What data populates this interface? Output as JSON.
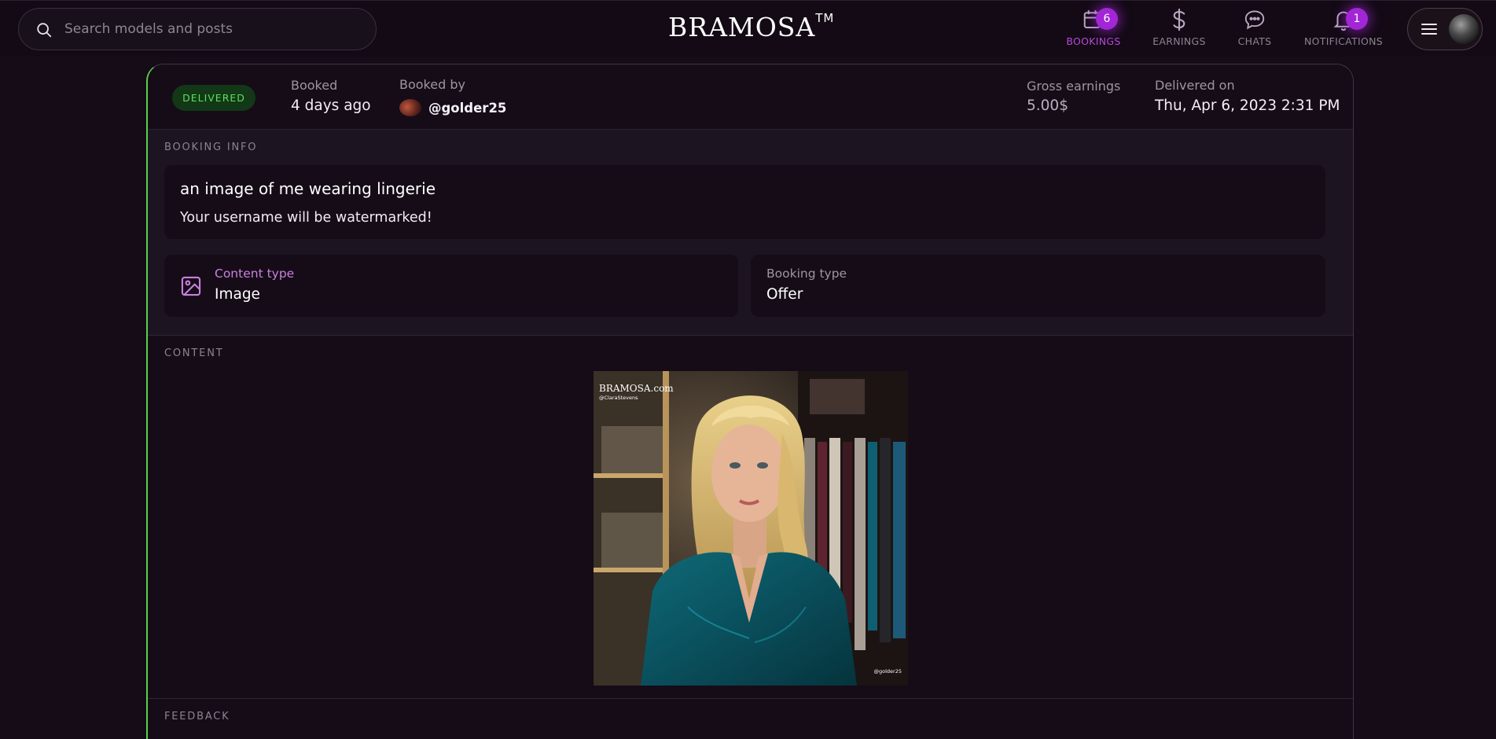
{
  "search": {
    "placeholder": "Search models and posts"
  },
  "brand": {
    "name": "BRAMOSA",
    "mark": "TM"
  },
  "nav": [
    {
      "label": "BOOKINGS",
      "icon": "calendar-icon",
      "badge": "6",
      "active": true
    },
    {
      "label": "EARNINGS",
      "icon": "dollar-icon",
      "badge": "",
      "active": false
    },
    {
      "label": "CHATS",
      "icon": "chat-bubble-icon",
      "badge": "",
      "active": false
    },
    {
      "label": "NOTIFICATIONS",
      "icon": "bell-icon",
      "badge": "1",
      "active": false
    }
  ],
  "booking": {
    "status": "DELIVERED",
    "booked_label": "Booked",
    "booked_value": "4 days ago",
    "booked_by_label": "Booked by",
    "booked_by_value": "@golder25",
    "gross_label": "Gross earnings",
    "gross_value": "5.00$",
    "delivered_label": "Delivered on",
    "delivered_value": "Thu, Apr 6, 2023 2:31 PM"
  },
  "info": {
    "section_title": "BOOKING INFO",
    "title": "an image of me wearing lingerie",
    "note": "Your username will be watermarked!",
    "content_type_label": "Content type",
    "content_type_value": "Image",
    "booking_type_label": "Booking type",
    "booking_type_value": "Offer"
  },
  "content": {
    "section_title": "CONTENT",
    "watermark_brand": "BRAMOSA.com",
    "watermark_model": "@ClaraStevens",
    "watermark_user": "@golder25"
  },
  "feedback": {
    "section_title": "FEEDBACK"
  },
  "colors": {
    "accent": "#a226d6",
    "status_green": "#5be05a",
    "background": "#150c17"
  }
}
